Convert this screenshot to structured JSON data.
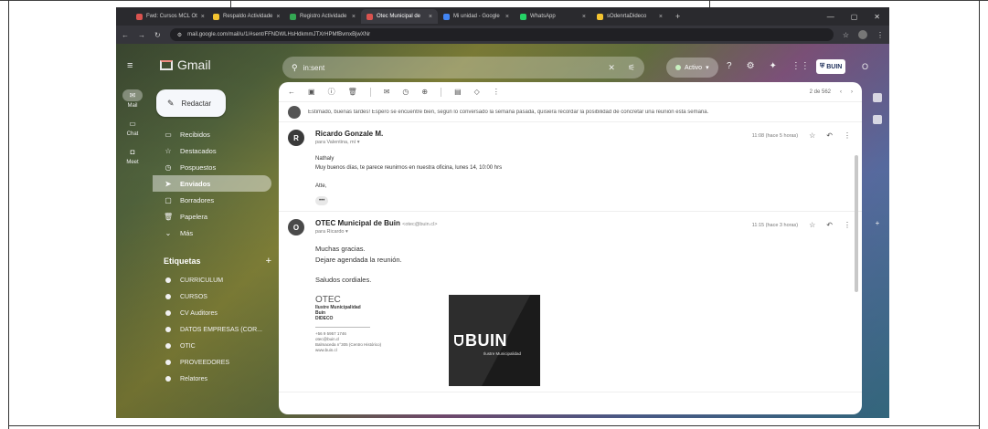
{
  "browser": {
    "tabs": [
      {
        "label": "Fwd: Cursos MCL Ot",
        "color": "#d9534f"
      },
      {
        "label": "Respaldo Actividade",
        "color": "#f4c430"
      },
      {
        "label": "Registro Actividade",
        "color": "#34a853"
      },
      {
        "label": "Otec Municipal de",
        "color": "#d9534f",
        "active": true
      },
      {
        "label": "Mi unidad - Google",
        "color": "#4285f4"
      },
      {
        "label": "WhatsApp",
        "color": "#25d366"
      },
      {
        "label": "sOdenrtaDideco",
        "color": "#f4c430"
      }
    ],
    "new_tab": "+",
    "url": "mail.google.com/mail/u/1/#sent/FFNDWLHsHdkmmJTXrHPMfBvmxBjwXNr",
    "window_controls": [
      "—",
      "▢",
      "✕"
    ]
  },
  "gmail": {
    "logo_text": "Gmail",
    "search_text": "in:sent",
    "status_label": "Activo",
    "badge_text": "BUIN",
    "avatar_letter": "O",
    "rail": [
      {
        "label": "Mail",
        "icon": "mail-icon",
        "glyph": "✉"
      },
      {
        "label": "Chat",
        "icon": "chat-icon",
        "glyph": "▭"
      },
      {
        "label": "Meet",
        "icon": "meet-icon",
        "glyph": "◘"
      }
    ],
    "compose_label": "Redactar",
    "folders": [
      {
        "label": "Recibidos",
        "glyph": "▭"
      },
      {
        "label": "Destacados",
        "glyph": "☆"
      },
      {
        "label": "Pospuestos",
        "glyph": "◷"
      },
      {
        "label": "Enviados",
        "glyph": "➤",
        "active": true
      },
      {
        "label": "Borradores",
        "glyph": "▢"
      },
      {
        "label": "Papelera",
        "glyph": "🗑"
      },
      {
        "label": "Más",
        "glyph": "⌄"
      }
    ],
    "labels_heading": "Etiquetas",
    "labels": [
      "CURRICULUM",
      "CURSOS",
      "CV Auditores",
      "DATOS EMPRESAS (COR...",
      "OTIC",
      "PROVEEDORES",
      "Relatores"
    ]
  },
  "thread": {
    "pager": "2 de 562",
    "collapsed_snippet": "Estimado, buenas tardes! Espero se encuentre bien, según lo conversado la semana pasada, quisiera recordar la posibilidad de concretar una reunión esta semana.",
    "messages": [
      {
        "avatar": "R",
        "sender": "Ricardo Gonzale M.",
        "sender_mail": "",
        "to": "para Valentina, mí ▾",
        "time": "11:08 (hace 5 horas)",
        "body": [
          "Nathaly",
          "Muy buenos días, te parece reunirnos en nuestra oficina, lunes 14, 10:00 hrs",
          "",
          "Atte,"
        ],
        "more": "•••"
      },
      {
        "avatar": "O",
        "sender": "OTEC Municipal de Buin",
        "sender_mail": "<otec@buin.cl>",
        "to": "para Ricardo ▾",
        "time": "11:15 (hace 3 horas)",
        "body": [
          "Muchas gracias.",
          "Dejare agendada la reunión.",
          "",
          "Saludos cordiales."
        ],
        "signature": {
          "title": "OTEC",
          "lines": [
            "Ilustre Municipalidad",
            "Buin",
            "DIDECO"
          ],
          "contact": [
            "+56 9 5957 1746",
            "otec@buin.cl",
            "Balmaceda n°305 (Centro Histórico)",
            "www.buin.cl"
          ],
          "logo_text": "BUIN",
          "logo_sub": "Ilustre Municipalidad"
        }
      }
    ]
  }
}
